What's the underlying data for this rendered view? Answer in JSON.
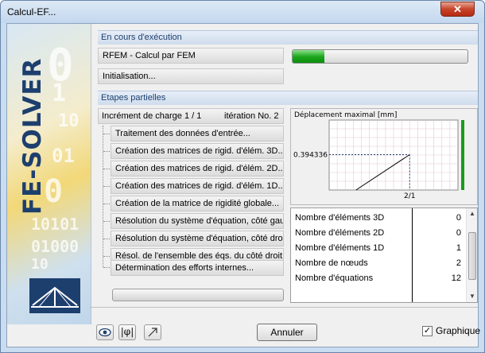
{
  "window": {
    "title": "Calcul-EF...",
    "close_label": "✕"
  },
  "banner": {
    "text": "FE-SOLVER"
  },
  "execution": {
    "header": "En cours d'exécution",
    "task": "RFEM - Calcul par FEM",
    "progress_percent": 18,
    "status": "Initialisation..."
  },
  "partial": {
    "header": "Etapes partielles",
    "increment": "Incrément de charge 1 / 1",
    "iteration": "itération No. 2",
    "steps": [
      "Traitement des données d'entrée...",
      "Création des matrices de rigid. d'élém. 3D...",
      "Création des matrices de rigid. d'élém. 2D...",
      "Création des matrices de rigid. d'élém. 1D...",
      "Création de la matrice de rigidité globale...",
      "Résolution du système d'équation, côté gauche",
      "Résolution du système d'équation, côté droit...",
      "Résol. de l'ensemble des éqs. du côté droit...",
      "Détermination des efforts internes..."
    ]
  },
  "chart_data": {
    "type": "line",
    "title": "Déplacement maximal [mm]",
    "x": [
      1,
      2,
      2
    ],
    "y": [
      0,
      0.394336,
      0.394336
    ],
    "point_label": "0.394336",
    "tick_label": "2/1",
    "color": "#000000",
    "accent_color": "#1a9c1a"
  },
  "stats": [
    {
      "label": "Nombre d'éléments 3D",
      "value": "0"
    },
    {
      "label": "Nombre d'éléments 2D",
      "value": "0"
    },
    {
      "label": "Nombre d'éléments 1D",
      "value": "1"
    },
    {
      "label": "Nombre de nœuds",
      "value": "2"
    },
    {
      "label": "Nombre d'équations",
      "value": "12"
    }
  ],
  "footer": {
    "view_icon": "eye-icon",
    "result_icon": "phi-icon",
    "arrow_icon": "arrow-icon",
    "cancel_label": "Annuler",
    "graph_label": "Graphique",
    "graph_checked": "✓"
  }
}
